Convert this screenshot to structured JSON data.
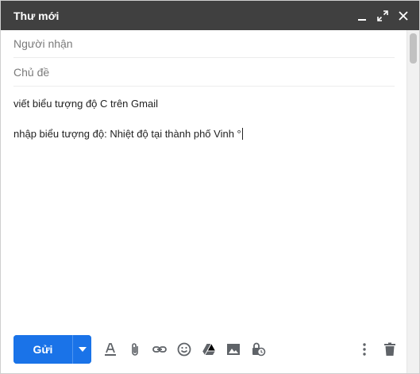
{
  "window": {
    "title": "Thư mới"
  },
  "fields": {
    "to_placeholder": "Người nhận",
    "subject_placeholder": "Chủ đề"
  },
  "body": {
    "line1": "viết biểu tượng độ C trên Gmail",
    "line2": "nhập biểu tượng độ: Nhiệt độ tại thành phố Vinh °"
  },
  "toolbar": {
    "send_label": "Gửi"
  },
  "colors": {
    "titlebar": "#404040",
    "send_button": "#1a73e8",
    "icon": "#5f6368"
  },
  "icons": {
    "minimize": "minimize-icon",
    "expand": "expand-icon",
    "close": "close-icon",
    "send_options": "caret-down-icon",
    "formatting": "text-format-icon",
    "attach": "paperclip-icon",
    "link": "link-icon",
    "emoji": "smiley-icon",
    "drive": "drive-icon",
    "photo": "image-icon",
    "confidential": "lock-clock-icon",
    "more": "more-vert-icon",
    "discard": "trash-icon"
  }
}
